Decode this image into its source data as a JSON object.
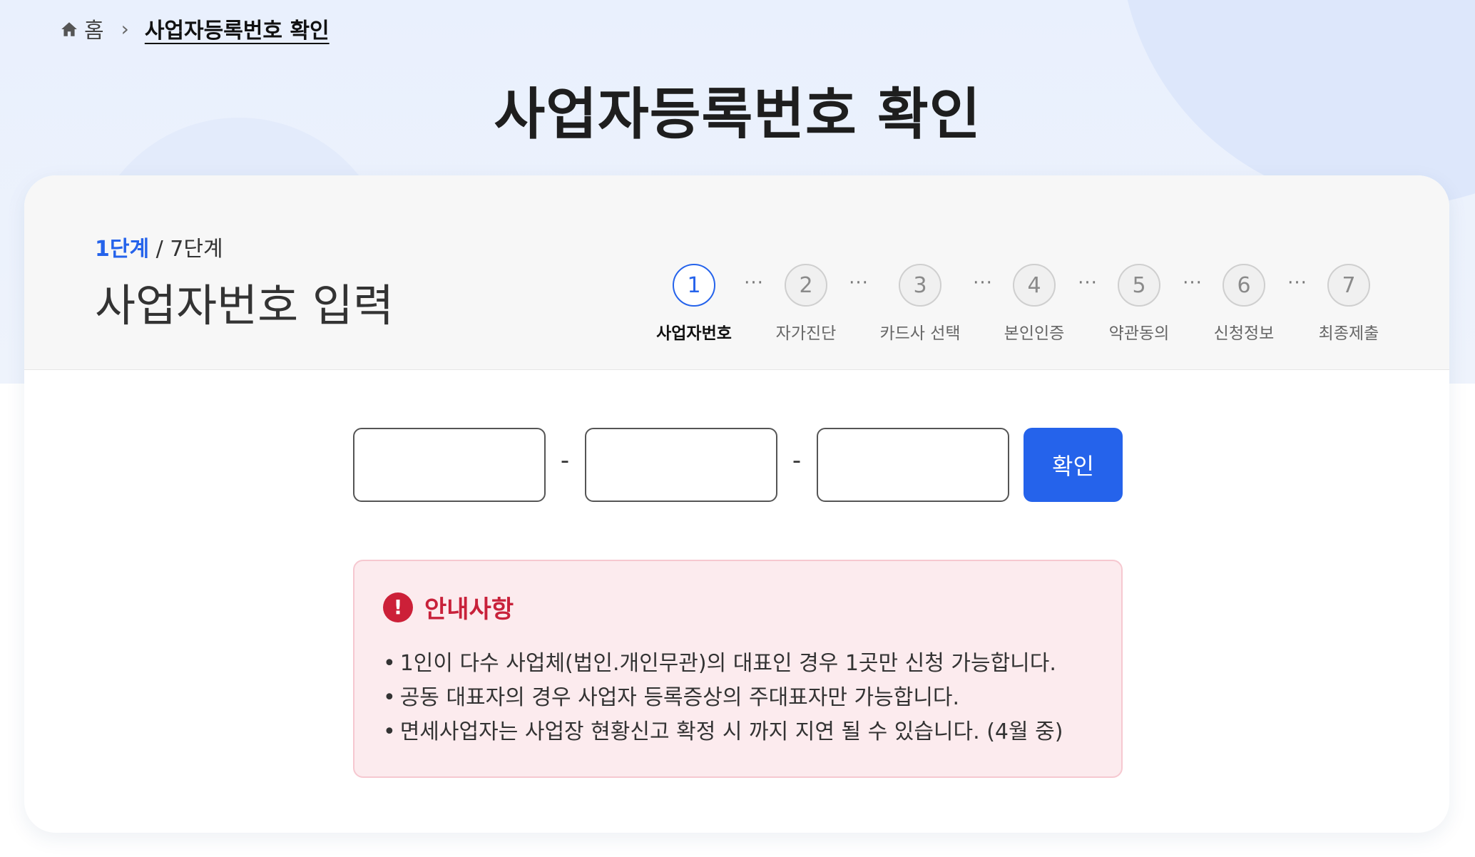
{
  "breadcrumb": {
    "home_icon": "home-icon",
    "home": "홈",
    "separator": "›",
    "current": "사업자등록번호 확인"
  },
  "page_title": "사업자등록번호 확인",
  "progress": {
    "current": "1단계",
    "separator": " / ",
    "total": "7단계",
    "section_title": "사업자번호 입력"
  },
  "stepper": {
    "dots": "···",
    "steps": [
      {
        "number": "1",
        "label": "사업자번호",
        "active": true
      },
      {
        "number": "2",
        "label": "자가진단",
        "active": false
      },
      {
        "number": "3",
        "label": "카드사 선택",
        "active": false
      },
      {
        "number": "4",
        "label": "본인인증",
        "active": false
      },
      {
        "number": "5",
        "label": "약관동의",
        "active": false
      },
      {
        "number": "6",
        "label": "신청정보",
        "active": false
      },
      {
        "number": "7",
        "label": "최종제출",
        "active": false
      }
    ]
  },
  "form": {
    "part1_value": "",
    "part2_value": "",
    "part3_value": "",
    "dash": "-",
    "confirm_label": "확인"
  },
  "notice": {
    "icon": "exclamation-circle-icon",
    "icon_glyph": "!",
    "title": "안내사항",
    "items": [
      "1인이 다수 사업체(법인.개인무관)의 대표인 경우 1곳만 신청 가능합니다.",
      "공동 대표자의 경우 사업자 등록증상의 주대표자만 가능합니다.",
      "면세사업자는 사업장 현황신고 확정 시 까지 지연 될 수 있습니다. (4월 중)"
    ]
  },
  "colors": {
    "accent": "#2563eb",
    "notice_bg": "#fcebee",
    "notice_title": "#c8213a",
    "hero_bg": "#e9f0fd"
  }
}
